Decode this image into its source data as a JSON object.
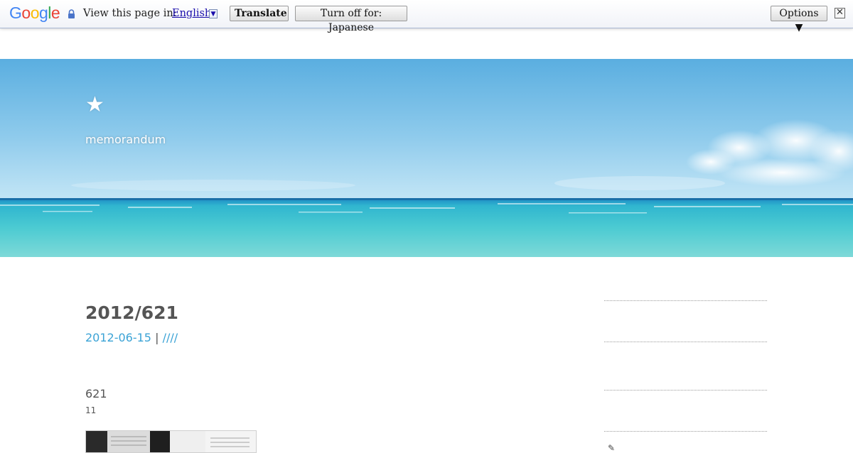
{
  "translate_bar": {
    "logo": [
      "G",
      "o",
      "o",
      "g",
      "l",
      "e"
    ],
    "logo_colors": [
      "#4285f4",
      "#ea4335",
      "#fbbc05",
      "#4285f4",
      "#34a853",
      "#ea4335"
    ],
    "prompt": "View this page in:",
    "language": "English",
    "translate_label": "Translate",
    "turn_off_label": "Turn off for: Japanese",
    "options_label": "Options ▼",
    "close_glyph": "✕"
  },
  "header": {
    "site_title": "★",
    "site_description": "memorandum"
  },
  "post": {
    "title": "2012/621",
    "date": "2012-06-15",
    "separator": "|",
    "category": "////",
    "body_line1": "621",
    "body_line2": "11"
  },
  "sidebar": {
    "icon": "pencil-icon"
  },
  "colors": {
    "link": "#3ba3d6",
    "text": "#555555",
    "sky_top": "#5aaee0",
    "sea": "#3cc3cf"
  }
}
